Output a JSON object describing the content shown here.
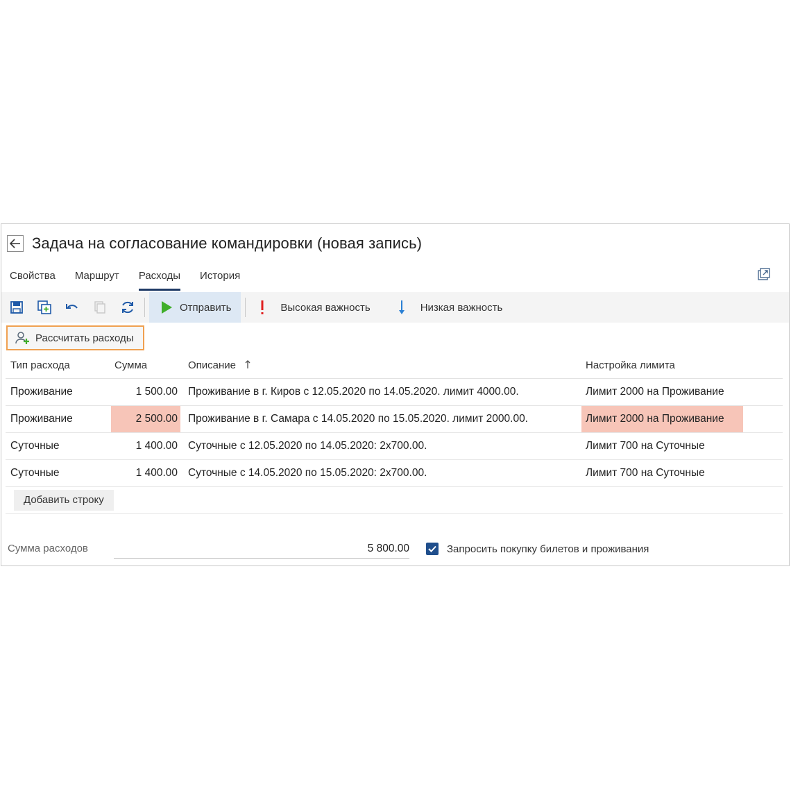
{
  "window": {
    "title": "Задача на согласование командировки (новая запись)"
  },
  "tabs": [
    {
      "label": "Свойства",
      "active": false
    },
    {
      "label": "Маршрут",
      "active": false
    },
    {
      "label": "Расходы",
      "active": true
    },
    {
      "label": "История",
      "active": false
    }
  ],
  "toolbar": {
    "icons": [
      "save-icon",
      "save-copy-icon",
      "undo-icon",
      "copy-icon",
      "refresh-icon"
    ],
    "send_label": "Отправить",
    "high_priority_label": "Высокая важность",
    "low_priority_label": "Низкая важность"
  },
  "calc_button": {
    "label": "Рассчитать расходы"
  },
  "grid": {
    "columns": {
      "type": "Тип расхода",
      "sum": "Сумма",
      "description": "Описание",
      "limit": "Настройка лимита"
    },
    "rows": [
      {
        "type": "Проживание",
        "sum": "1 500.00",
        "description": "Проживание в г. Киров с 12.05.2020 по 14.05.2020. лимит 4000.00.",
        "limit": "Лимит 2000 на Проживание",
        "highlight": false
      },
      {
        "type": "Проживание",
        "sum": "2 500.00",
        "description": "Проживание в г. Самара с 14.05.2020 по 15.05.2020. лимит 2000.00.",
        "limit": "Лимит 2000 на Проживание",
        "highlight": true
      },
      {
        "type": "Суточные",
        "sum": "1 400.00",
        "description": "Суточные с 12.05.2020 по 14.05.2020: 2x700.00.",
        "limit": "Лимит 700 на Суточные",
        "highlight": false
      },
      {
        "type": "Суточные",
        "sum": "1 400.00",
        "description": "Суточные с 14.05.2020 по 15.05.2020: 2x700.00.",
        "limit": "Лимит 700 на Суточные",
        "highlight": false
      }
    ],
    "add_row_label": "Добавить строку"
  },
  "footer": {
    "sum_label": "Сумма расходов",
    "sum_value": "5 800.00",
    "checkbox_label": "Запросить покупку билетов и проживания",
    "checkbox_checked": true
  },
  "colors": {
    "accent": "#1f3a66",
    "highlight": "#f7c5b8",
    "send_green": "#3fae2a",
    "high_priority": "#e02020",
    "low_priority": "#2a7fd4",
    "calc_border": "#f0a050"
  }
}
